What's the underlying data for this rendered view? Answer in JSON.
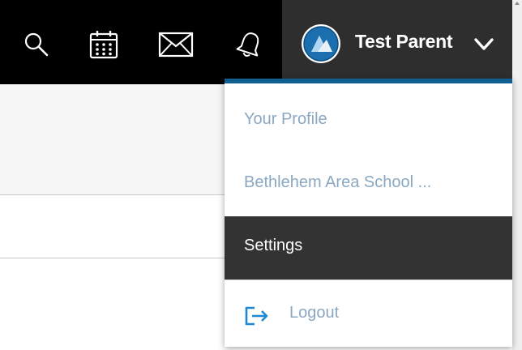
{
  "header": {
    "icons": [
      "search-icon",
      "calendar-icon",
      "mail-icon",
      "bell-icon"
    ],
    "user": {
      "name": "Test Parent",
      "avatar_icon": "avatar-logo-icon",
      "dropdown_icon": "chevron-down-icon"
    }
  },
  "dropdown": {
    "accent_color": "#0f5f91",
    "items": [
      {
        "label": "Your Profile"
      },
      {
        "label": "Bethlehem Area School ..."
      },
      {
        "label": "Settings",
        "active": true
      },
      {
        "label": "Logout",
        "icon": "logout-icon"
      }
    ]
  },
  "colors": {
    "topbar": "#000000",
    "user_area": "#2e2e2e",
    "menu_text": "#8aa8c2",
    "menu_active_bg": "#333333"
  }
}
